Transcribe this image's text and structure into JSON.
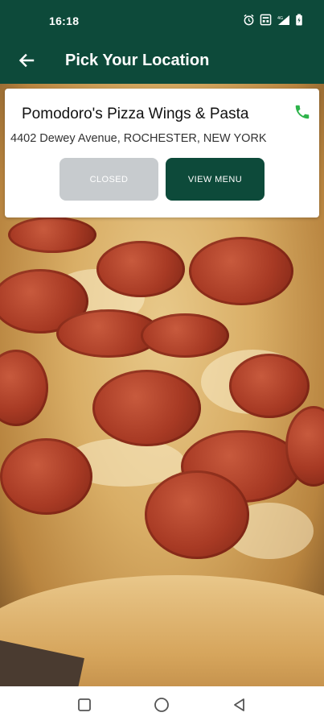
{
  "status_bar": {
    "time": "16:18",
    "icons": [
      "alarm-icon",
      "data-saver-icon",
      "signal-icon",
      "battery-icon"
    ]
  },
  "app_bar": {
    "title": "Pick Your Location",
    "back_icon": "back-arrow-icon"
  },
  "restaurant": {
    "name": "Pomodoro's Pizza Wings & Pasta",
    "address": "4402 Dewey Avenue, ROCHESTER, NEW YORK",
    "phone_icon": "phone-icon",
    "closed_label": "CLOSED",
    "menu_label": "VIEW MENU"
  },
  "nav_bar": {
    "icons": [
      "recents-square-icon",
      "home-circle-icon",
      "back-triangle-icon"
    ]
  },
  "colors": {
    "brand": "#0d4a3a",
    "phone": "#2db34a",
    "closed_button": "#c7cbce"
  }
}
